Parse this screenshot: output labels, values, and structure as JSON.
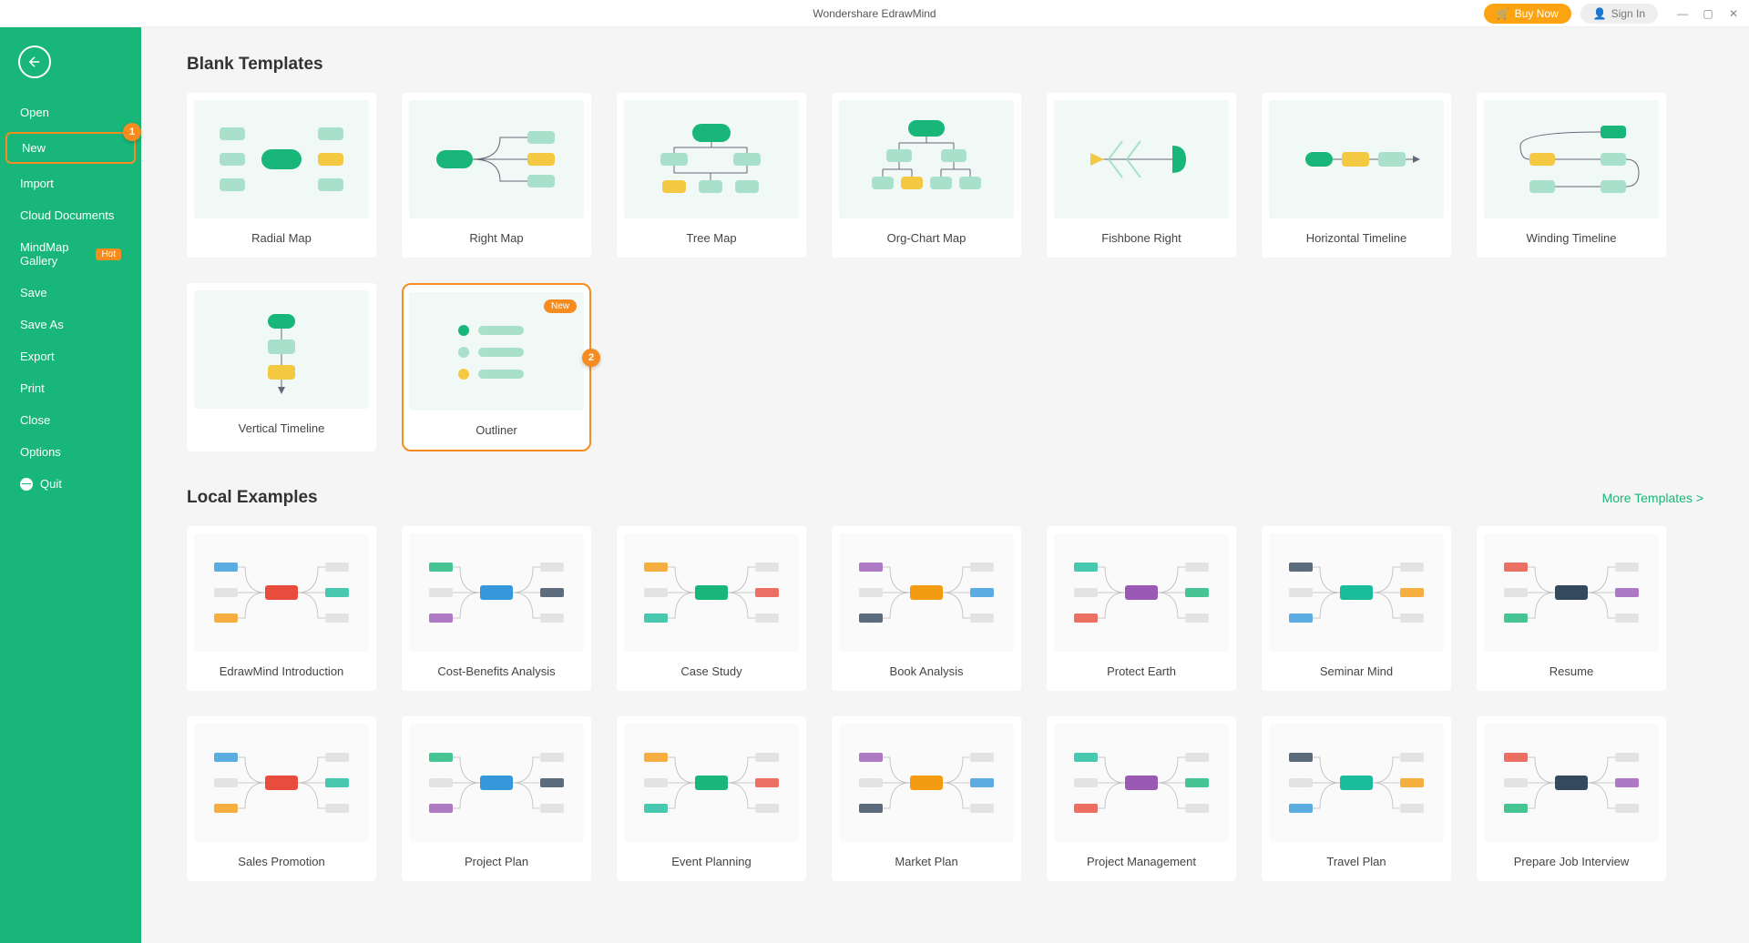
{
  "app_title": "Wondershare EdrawMind",
  "titlebar": {
    "buy_now": "Buy Now",
    "sign_in": "Sign In"
  },
  "sidebar": {
    "items": [
      {
        "label": "Open"
      },
      {
        "label": "New",
        "active": true
      },
      {
        "label": "Import"
      },
      {
        "label": "Cloud Documents"
      },
      {
        "label": "MindMap Gallery",
        "hot": "Hot"
      },
      {
        "label": "Save"
      },
      {
        "label": "Save As"
      },
      {
        "label": "Export"
      },
      {
        "label": "Print"
      },
      {
        "label": "Close"
      },
      {
        "label": "Options"
      },
      {
        "label": "Quit",
        "icon": "quit"
      }
    ]
  },
  "annotations": {
    "anno1": "1",
    "anno2": "2"
  },
  "sections": {
    "blank_templates": {
      "title": "Blank Templates",
      "items": [
        {
          "label": "Radial Map"
        },
        {
          "label": "Right Map"
        },
        {
          "label": "Tree Map"
        },
        {
          "label": "Org-Chart Map"
        },
        {
          "label": "Fishbone Right"
        },
        {
          "label": "Horizontal Timeline"
        },
        {
          "label": "Winding Timeline"
        },
        {
          "label": "Vertical Timeline"
        },
        {
          "label": "Outliner",
          "new": "New",
          "highlighted": true
        }
      ]
    },
    "local_examples": {
      "title": "Local Examples",
      "more": "More Templates >",
      "items": [
        {
          "label": "EdrawMind Introduction"
        },
        {
          "label": "Cost-Benefits Analysis"
        },
        {
          "label": "Case Study"
        },
        {
          "label": "Book Analysis"
        },
        {
          "label": "Protect Earth"
        },
        {
          "label": "Seminar Mind"
        },
        {
          "label": "Resume"
        },
        {
          "label": "Sales Promotion"
        },
        {
          "label": "Project Plan"
        },
        {
          "label": "Event Planning"
        },
        {
          "label": "Market Plan"
        },
        {
          "label": "Project Management"
        },
        {
          "label": "Travel Plan"
        },
        {
          "label": "Prepare Job Interview"
        }
      ]
    }
  }
}
